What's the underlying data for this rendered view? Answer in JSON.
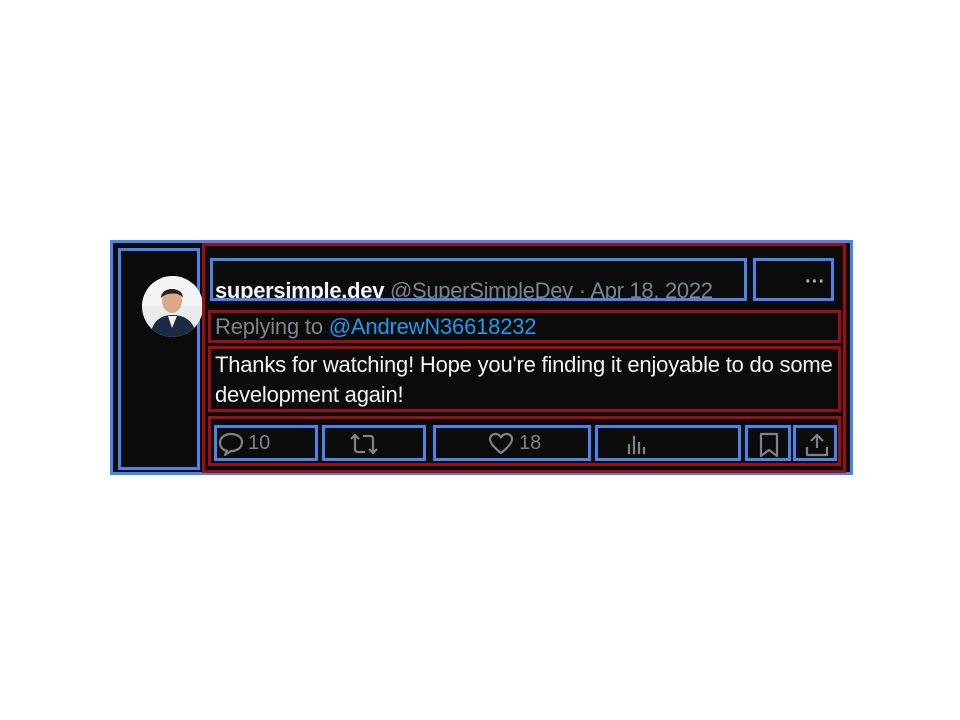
{
  "tweet": {
    "author_name": "supersimple.dev",
    "author_handle": "@SuperSimpleDev",
    "separator": "·",
    "date": "Apr 18, 2022",
    "more_icon": "more-horizontal-icon",
    "more_label": "···",
    "replying_label": "Replying to",
    "replying_to": "@AndrewN36618232",
    "text": "Thanks for watching! Hope you're finding it enjoyable to do some development again!",
    "avatar_icon": "avatar-photo"
  },
  "actions": {
    "reply_count": "10",
    "retweet_count": "",
    "like_count": "18",
    "views_count": "",
    "icons": [
      "reply-icon",
      "retweet-icon",
      "like-icon",
      "views-icon",
      "bookmark-icon",
      "share-icon"
    ]
  },
  "colors": {
    "background": "#0b0b0c",
    "text_primary": "#f1f3f5",
    "text_secondary": "#7c838b",
    "link": "#1d9bf0",
    "annotation_blue": "#4b84e8",
    "annotation_red": "#9b0f14"
  }
}
